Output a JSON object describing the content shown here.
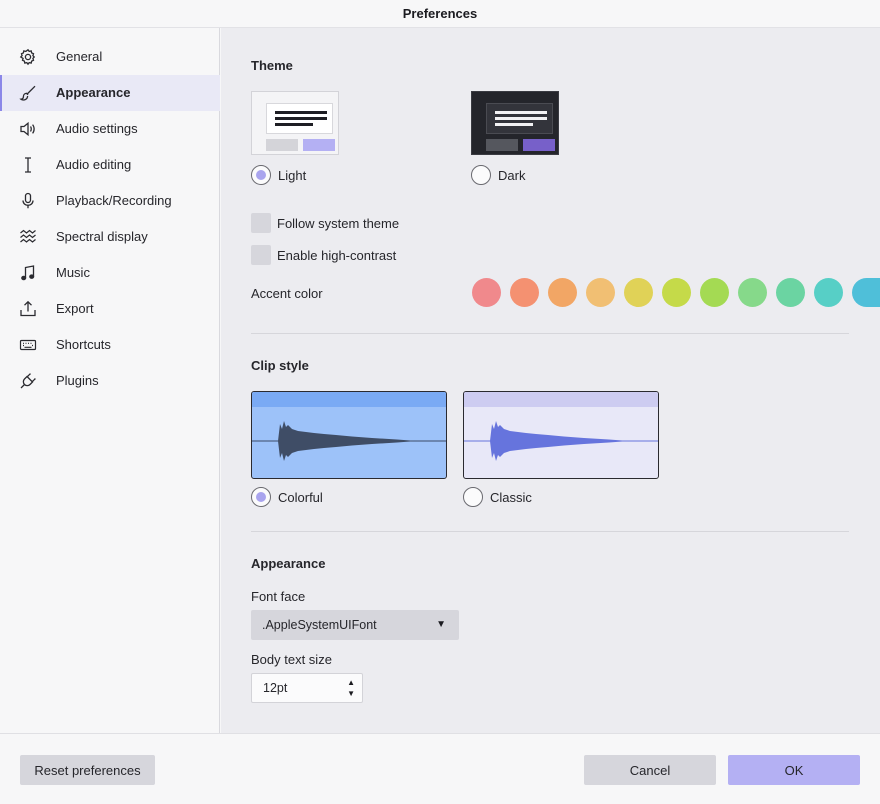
{
  "window": {
    "title": "Preferences"
  },
  "sidebar": {
    "items": [
      {
        "label": "General",
        "icon": "gear-icon"
      },
      {
        "label": "Appearance",
        "icon": "brush-icon",
        "active": true
      },
      {
        "label": "Audio settings",
        "icon": "speaker-icon"
      },
      {
        "label": "Audio editing",
        "icon": "text-cursor-icon"
      },
      {
        "label": "Playback/Recording",
        "icon": "microphone-icon"
      },
      {
        "label": "Spectral display",
        "icon": "spectral-icon"
      },
      {
        "label": "Music",
        "icon": "music-note-icon"
      },
      {
        "label": "Export",
        "icon": "upload-icon"
      },
      {
        "label": "Shortcuts",
        "icon": "keyboard-icon"
      },
      {
        "label": "Plugins",
        "icon": "plug-icon"
      }
    ]
  },
  "theme": {
    "title": "Theme",
    "options": [
      {
        "label": "Light",
        "selected": true
      },
      {
        "label": "Dark",
        "selected": false
      }
    ],
    "follow_system": {
      "label": "Follow system theme",
      "checked": false
    },
    "high_contrast": {
      "label": "Enable high-contrast",
      "checked": false
    },
    "accent_label": "Accent color",
    "accent_colors": [
      "#f0898c",
      "#f49171",
      "#f2a665",
      "#f1bf73",
      "#e0d257",
      "#c5da49",
      "#a4da53",
      "#86d98a",
      "#6bd4a2",
      "#57cfc6",
      "#4fbfd9"
    ]
  },
  "clip_style": {
    "title": "Clip style",
    "options": [
      {
        "label": "Colorful",
        "selected": true
      },
      {
        "label": "Classic",
        "selected": false
      }
    ]
  },
  "appearance": {
    "title": "Appearance",
    "font_face_label": "Font face",
    "font_face_value": ".AppleSystemUIFont",
    "body_size_label": "Body text size",
    "body_size_value": "12pt"
  },
  "footer": {
    "reset_label": "Reset preferences",
    "cancel_label": "Cancel",
    "ok_label": "OK"
  },
  "colors": {
    "accent": "#8b87e8",
    "primary_button": "#b4b0f3",
    "colorful_clip_bg": "#9dc2f9",
    "colorful_clip_header": "#7aaaf4",
    "classic_clip_bg": "#e8e8f8",
    "classic_clip_header": "#cdccf1",
    "classic_wave": "#6674dd"
  }
}
